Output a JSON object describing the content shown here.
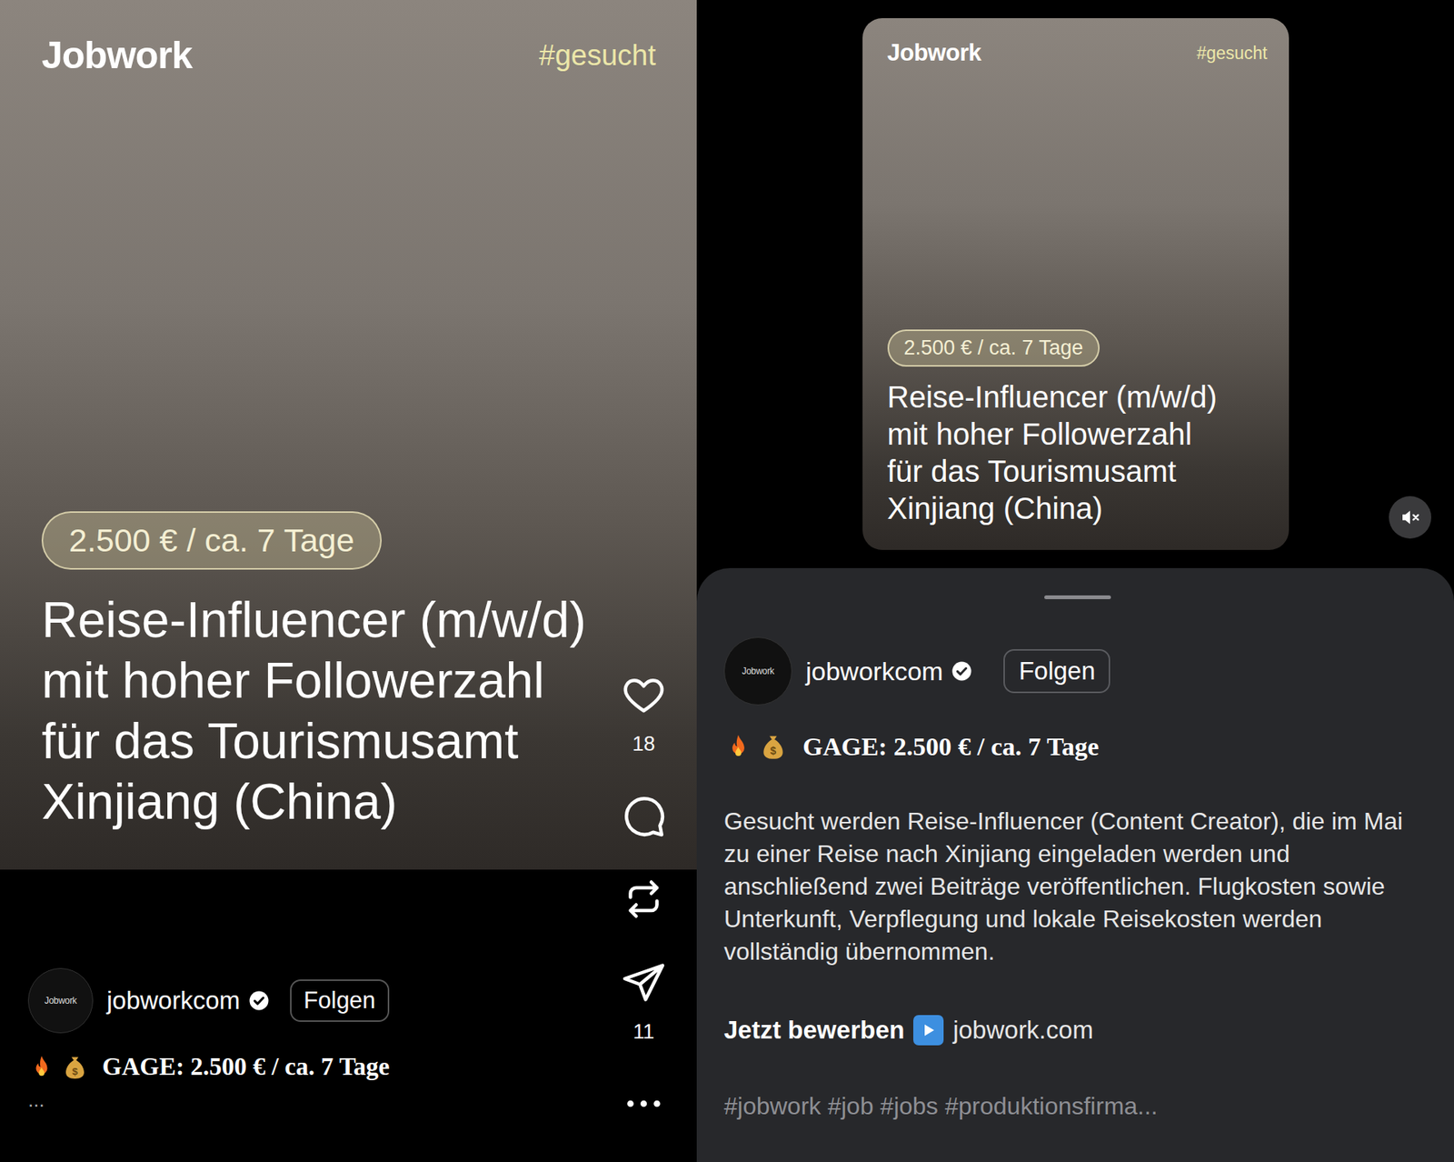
{
  "post": {
    "brand": "Jobwork",
    "hashtag": "#gesucht",
    "fee": "2.500 € / ca. 7 Tage",
    "headline": [
      "Reise-Influencer (m/w/d)",
      "mit hoher Followerzahl",
      "für das Tourismusamt",
      "Xinjiang (China)"
    ]
  },
  "account": {
    "username": "jobworkcom",
    "avatar": "Jobwork",
    "verified": true,
    "follow": "Folgen"
  },
  "actions": [
    {
      "kind": "like",
      "count": "18"
    },
    {
      "kind": "comment",
      "count": ""
    },
    {
      "kind": "repost",
      "count": ""
    },
    {
      "kind": "share",
      "count": "11"
    },
    {
      "kind": "more",
      "count": ""
    }
  ],
  "caption": {
    "title": "GAGE: 2.500 € / ca. 7 Tage",
    "more": "..."
  },
  "sheet": {
    "description": "Gesucht werden Reise-Influencer (Content Creator), die im Mai zu einer Reise nach Xinjiang eingeladen werden und anschließend zwei Beiträge veröffentlichen. Flugkosten sowie Unterkunft, Verpflegung und lokale Reisekosten werden vollständig übernommen.",
    "cta": "Jetzt bewerben",
    "link": "jobwork.com",
    "hashtags": "#jobwork #job #jobs #produktionsfirma..."
  },
  "muted": true
}
